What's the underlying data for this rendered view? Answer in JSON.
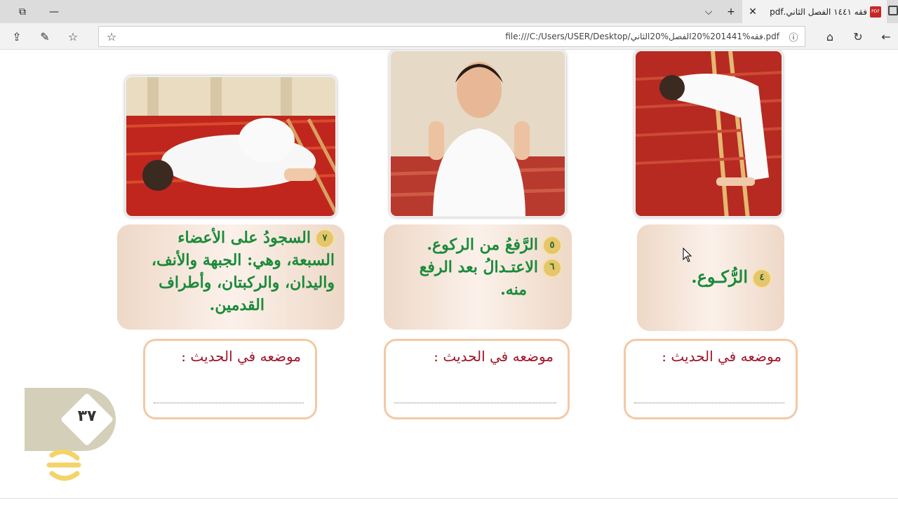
{
  "browser": {
    "tab_title": "فقه ١٤٤١ الفصل الثاني.pdf",
    "url": "file:///C:/Users/USER/Desktop/فقه%201441%20الفصل%20الثاني.pdf"
  },
  "cards": [
    {
      "badges": [
        "٧"
      ],
      "lines": [
        "السجودُ على الأعضاء",
        "السبعة، وهي: الجبهة والأنف،",
        "واليدان، والركبتان، وأطراف",
        "القدمين."
      ]
    },
    {
      "badges": [
        "٥",
        "٦"
      ],
      "lines": [
        "الرَّفعُ من الركوع.",
        "الاعتـدالُ بعد الرفع",
        "منه."
      ]
    },
    {
      "badges": [
        "٤"
      ],
      "lines": [
        "الرُّكـوع."
      ]
    }
  ],
  "hadith_label": "موضعه في الحديث :",
  "page_number": "٣٧"
}
